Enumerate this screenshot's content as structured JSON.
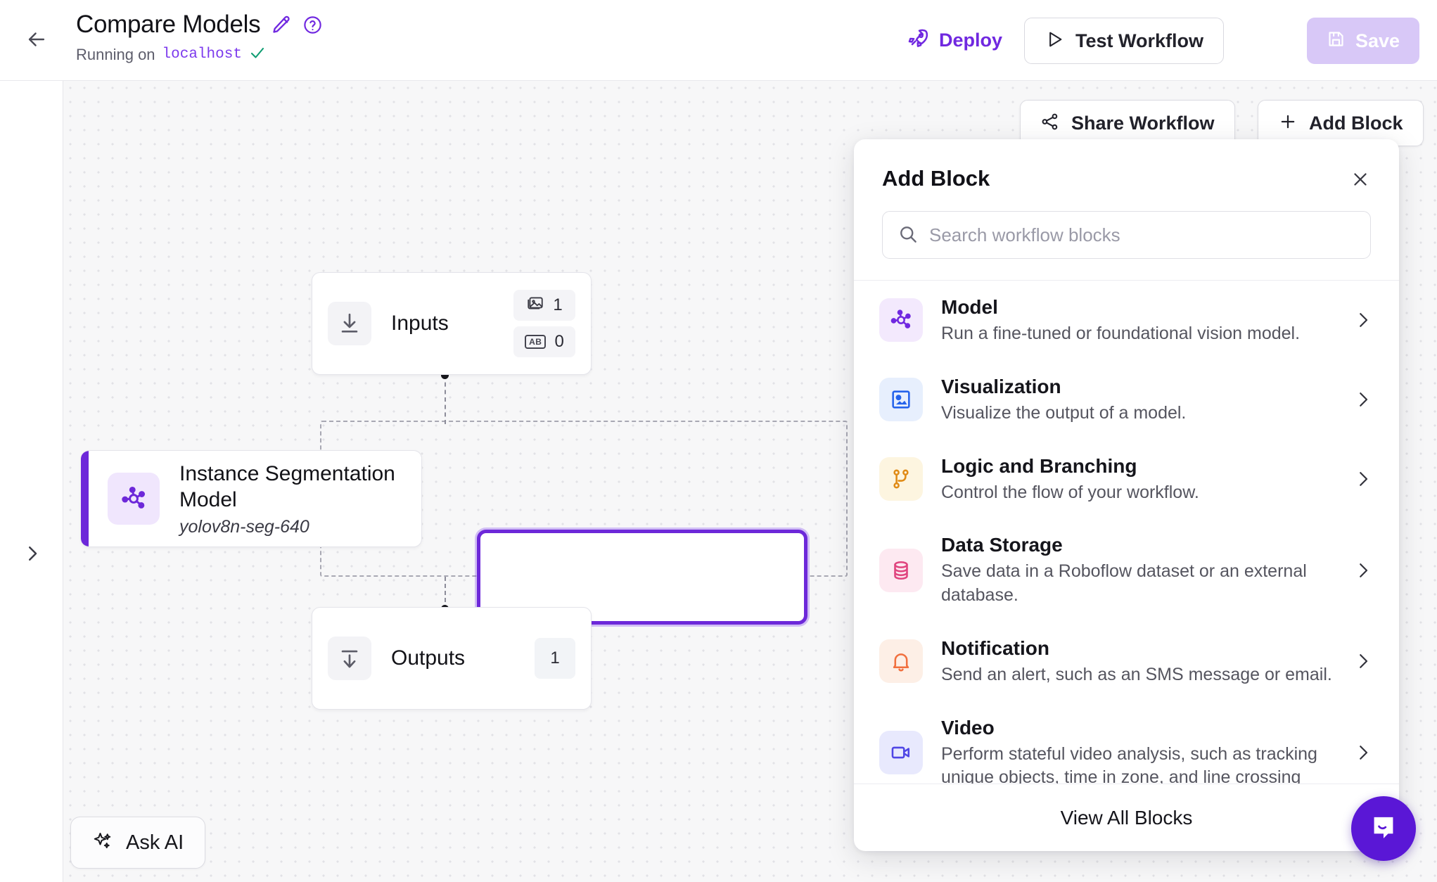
{
  "header": {
    "back_icon": "arrow-left-icon",
    "title": "Compare Models",
    "edit_icon": "pencil-icon",
    "help_icon": "question-circle-icon",
    "status_prefix": "Running on",
    "status_host": "localhost",
    "status_check_icon": "check-icon",
    "deploy_label": "Deploy",
    "deploy_icon": "rocket-icon",
    "test_label": "Test Workflow",
    "test_icon": "play-icon",
    "save_label": "Save",
    "save_icon": "floppy-disk-icon",
    "accent_purple": "#7028e0",
    "save_bg": "#d8c8f7"
  },
  "canvas": {
    "expand_icon": "chevron-right-icon",
    "share_label": "Share Workflow",
    "share_icon": "share-nodes-icon",
    "add_block_label": "Add Block",
    "add_block_icon": "plus-icon",
    "ask_ai_label": "Ask AI",
    "ask_ai_icon": "sparkles-icon",
    "nodes": {
      "inputs": {
        "title": "Inputs",
        "icon": "download-icon",
        "image_badge_icon": "image-icon",
        "image_badge_value": "1",
        "text_badge_icon": "ab-text-icon",
        "text_badge_value": "0"
      },
      "model": {
        "title": "Instance Segmentation Model",
        "subtitle": "yolov8n-seg-640",
        "icon": "model-nodes-icon",
        "accent": "#6d28d9"
      },
      "selected": {
        "title": "",
        "accent": "#6d28d9"
      },
      "outputs": {
        "title": "Outputs",
        "icon": "upload-export-icon",
        "badge_value": "1"
      }
    }
  },
  "panel": {
    "title": "Add Block",
    "close_icon": "close-icon",
    "search": {
      "icon": "search-icon",
      "placeholder": "Search workflow blocks",
      "value": ""
    },
    "footer_label": "View All Blocks",
    "chevron_icon": "chevron-right-icon",
    "blocks": [
      {
        "name": "Model",
        "desc": "Run a fine-tuned or foundational vision model.",
        "icon": "model-nodes-icon",
        "icon_color": "#7028e0",
        "icon_bg": "#f3e9fd"
      },
      {
        "name": "Visualization",
        "desc": "Visualize the output of a model.",
        "icon": "image-square-icon",
        "icon_color": "#2563eb",
        "icon_bg": "#e7effd"
      },
      {
        "name": "Logic and Branching",
        "desc": "Control the flow of your workflow.",
        "icon": "git-branch-icon",
        "icon_color": "#e08b16",
        "icon_bg": "#fdf5e0"
      },
      {
        "name": "Data Storage",
        "desc": "Save data in a Roboflow dataset or an external database.",
        "icon": "database-icon",
        "icon_color": "#e0457f",
        "icon_bg": "#fde9f1"
      },
      {
        "name": "Notification",
        "desc": "Send an alert, such as an SMS message or email.",
        "icon": "bell-icon",
        "icon_color": "#f1703f",
        "icon_bg": "#fdefe6"
      },
      {
        "name": "Video",
        "desc": "Perform stateful video analysis, such as tracking unique objects, time in zone, and line crossing",
        "icon": "video-camera-icon",
        "icon_color": "#4f46e5",
        "icon_bg": "#e8e9fd"
      }
    ]
  },
  "chat": {
    "launcher_icon": "chat-bubble-icon",
    "color": "#5a17d6"
  }
}
